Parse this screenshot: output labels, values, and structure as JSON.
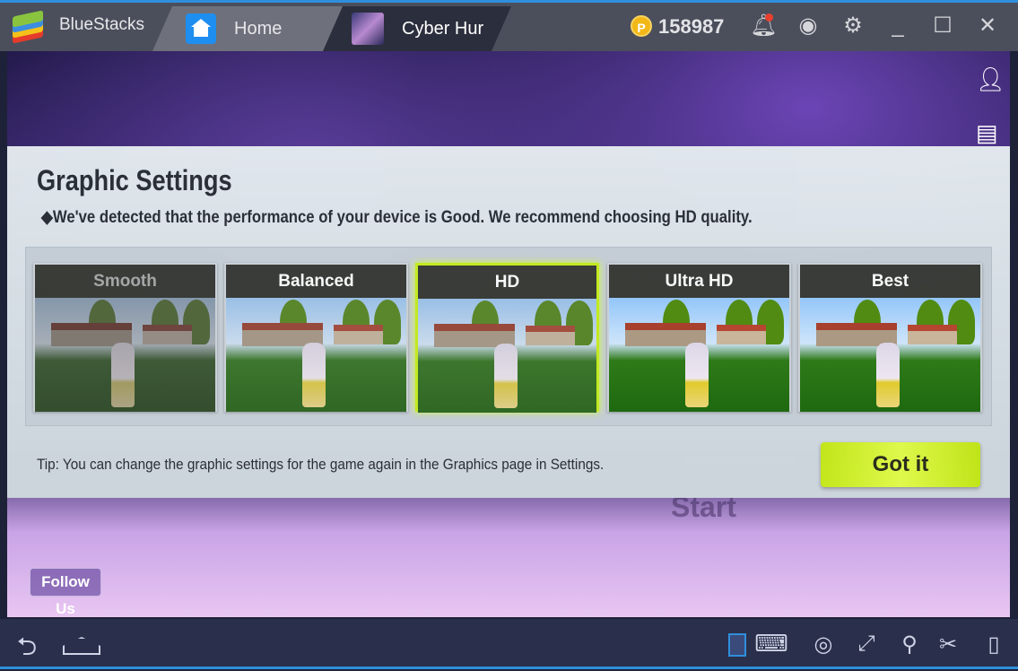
{
  "titlebar": {
    "app_name": "BlueStacks",
    "tabs": [
      {
        "label": "Home",
        "icon": "home-icon"
      },
      {
        "label": "Cyber Hur",
        "icon": "game-icon"
      }
    ],
    "coin_symbol": "P",
    "coins": "158987",
    "notification_color": "#e8402f"
  },
  "dialog": {
    "title": "Graphic Settings",
    "subtitle": "◆We've detected that the performance of your device is Good. We recommend choosing HD quality.",
    "options": [
      {
        "label": "Smooth"
      },
      {
        "label": "Balanced"
      },
      {
        "label": "HD",
        "selected": true
      },
      {
        "label": "Ultra HD"
      },
      {
        "label": "Best"
      }
    ],
    "tip": "Tip: You can change the graphic settings for the game again in the Graphics page in Settings.",
    "confirm": "Got it",
    "accent": "#c8f020"
  },
  "game": {
    "follow_us": "Follow Us",
    "start": "Start"
  },
  "bottombar": {
    "icons": [
      "back-icon",
      "home-icon",
      "keymap-icon",
      "keyboard-icon",
      "eye-icon",
      "fullscreen-icon",
      "location-icon",
      "scissors-icon",
      "shake-icon"
    ]
  }
}
